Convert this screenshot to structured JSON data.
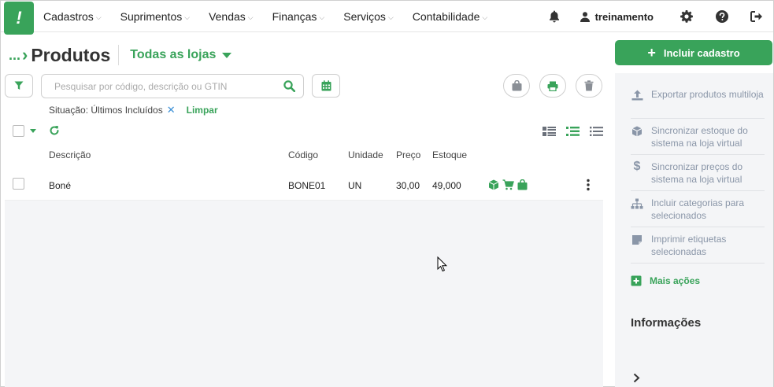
{
  "nav": {
    "logo": "!",
    "menu": [
      {
        "label": "Cadastros"
      },
      {
        "label": "Suprimentos"
      },
      {
        "label": "Vendas"
      },
      {
        "label": "Finanças"
      },
      {
        "label": "Serviços"
      },
      {
        "label": "Contabilidade"
      }
    ],
    "user": "treinamento"
  },
  "header": {
    "breadcrumb_dots": "...",
    "title": "Produtos",
    "store_select": "Todas as lojas",
    "include_button": "Incluir cadastro"
  },
  "search": {
    "placeholder": "Pesquisar por código, descrição ou GTIN",
    "value": ""
  },
  "filter": {
    "status_text": "Situação: Últimos Incluídos",
    "remove_symbol": "✕",
    "clear_label": "Limpar"
  },
  "table": {
    "columns": [
      "Descrição",
      "Código",
      "Unidade",
      "Preço",
      "Estoque"
    ],
    "rows": [
      {
        "descricao": "Boné",
        "codigo": "BONE01",
        "unidade": "UN",
        "preco": "30,00",
        "estoque": "49,000"
      }
    ]
  },
  "side_actions": [
    {
      "icon": "upload-icon",
      "label": "Exportar produtos multiloja"
    },
    {
      "icon": "box-icon",
      "label": "Sincronizar estoque do sistema na loja virtual"
    },
    {
      "icon": "dollar-icon",
      "label": "Sincronizar preços do sistema na loja virtual"
    },
    {
      "icon": "sitemap-icon",
      "label": "Incluir categorias para selecionados"
    },
    {
      "icon": "label-icon",
      "label": "Imprimir etiquetas selecionadas"
    }
  ],
  "more_actions_label": "Mais ações",
  "info_title": "Informações",
  "colors": {
    "brand_green": "#39a35a",
    "muted_text": "#8a96a8",
    "panel_bg": "#f4f5f7"
  }
}
